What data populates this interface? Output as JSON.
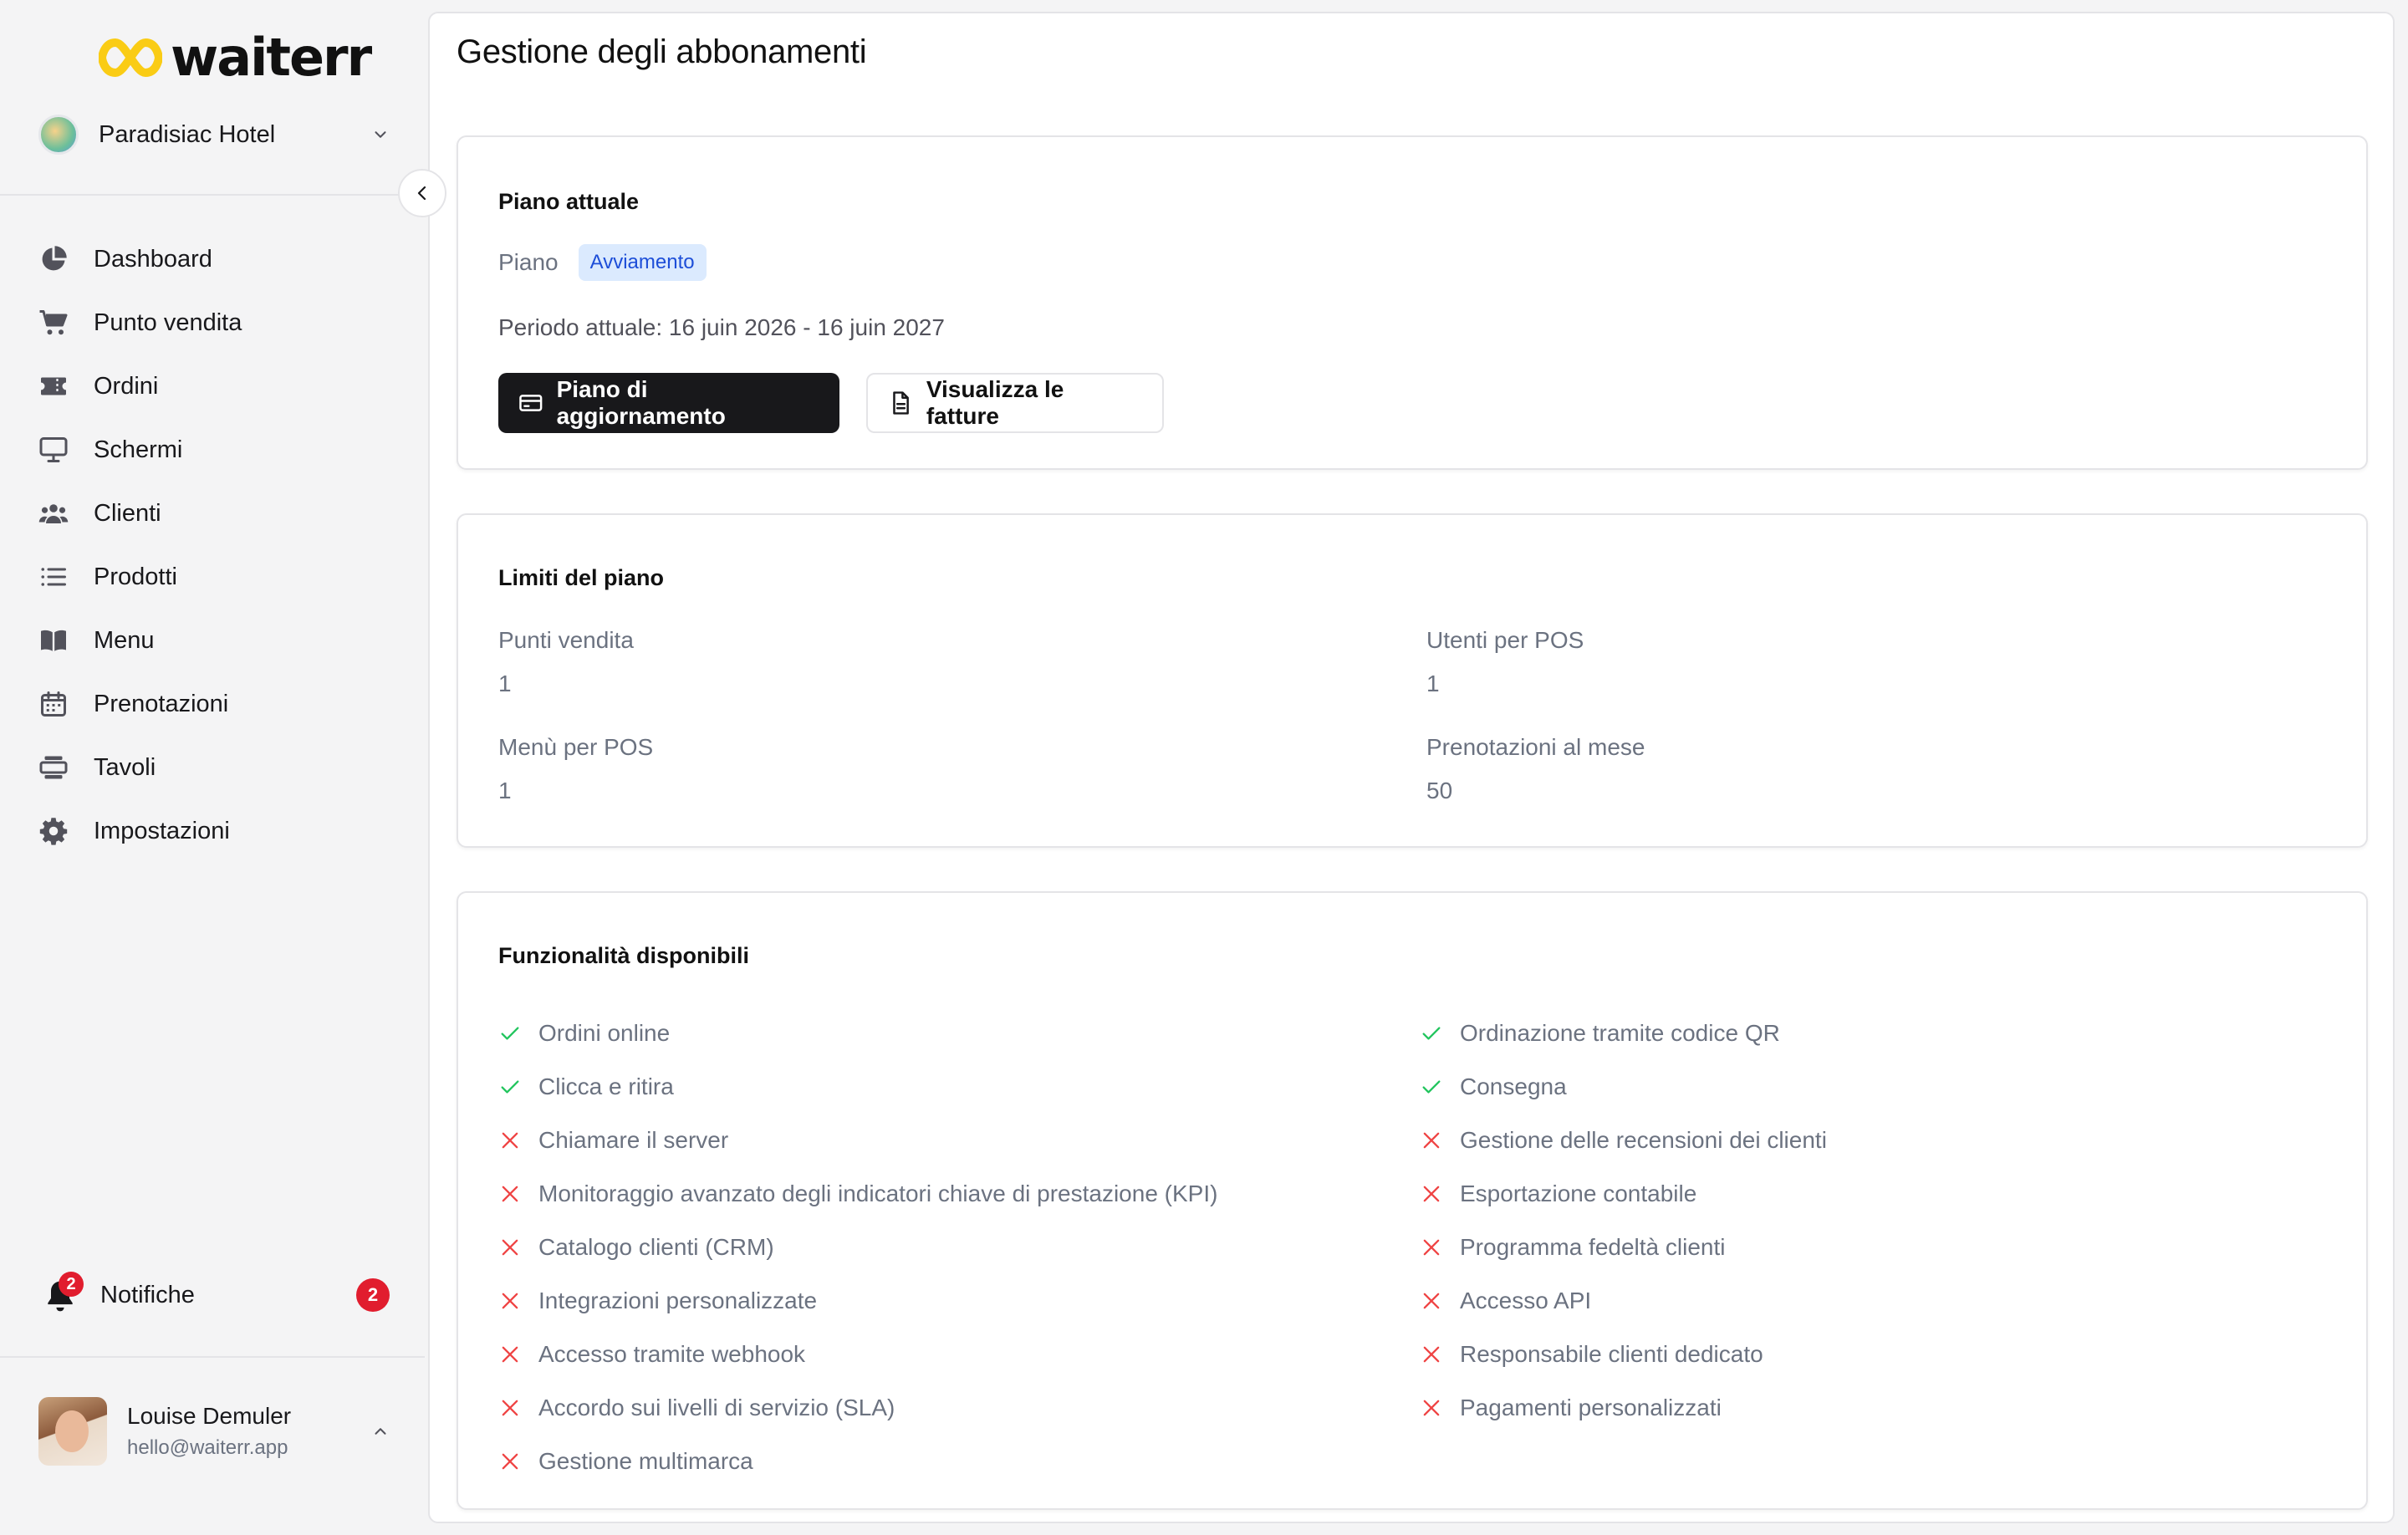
{
  "brand": {
    "name": "waiterr"
  },
  "org": {
    "name": "Paradisiac Hotel"
  },
  "nav": [
    {
      "label": "Dashboard",
      "icon": "pie-chart-icon"
    },
    {
      "label": "Punto vendita",
      "icon": "cart-icon"
    },
    {
      "label": "Ordini",
      "icon": "ticket-icon"
    },
    {
      "label": "Schermi",
      "icon": "monitor-icon"
    },
    {
      "label": "Clienti",
      "icon": "users-icon"
    },
    {
      "label": "Prodotti",
      "icon": "list-icon"
    },
    {
      "label": "Menu",
      "icon": "book-icon"
    },
    {
      "label": "Prenotazioni",
      "icon": "calendar-icon"
    },
    {
      "label": "Tavoli",
      "icon": "table-icon"
    },
    {
      "label": "Impostazioni",
      "icon": "gear-icon"
    }
  ],
  "notifications": {
    "label": "Notifiche",
    "count": "2"
  },
  "user": {
    "name": "Louise Demuler",
    "email": "hello@waiterr.app"
  },
  "page": {
    "title": "Gestione degli abbonamenti"
  },
  "current_plan": {
    "title": "Piano attuale",
    "plan_label": "Piano",
    "plan_badge": "Avviamento",
    "period": "Periodo attuale: 16 juin 2026 - 16 juin 2027",
    "upgrade_button": "Piano di aggiornamento",
    "invoices_button": "Visualizza le fatture"
  },
  "limits": {
    "title": "Limiti del piano",
    "items": [
      {
        "label": "Punti vendita",
        "value": "1"
      },
      {
        "label": "Utenti per POS",
        "value": "1"
      },
      {
        "label": "Menù per POS",
        "value": "1"
      },
      {
        "label": "Prenotazioni al mese",
        "value": "50"
      }
    ]
  },
  "features": {
    "title": "Funzionalità disponibili",
    "left": [
      {
        "label": "Ordini online",
        "available": true
      },
      {
        "label": "Clicca e ritira",
        "available": true
      },
      {
        "label": "Chiamare il server",
        "available": false
      },
      {
        "label": "Monitoraggio avanzato degli indicatori chiave di prestazione (KPI)",
        "available": false
      },
      {
        "label": "Catalogo clienti (CRM)",
        "available": false
      },
      {
        "label": "Integrazioni personalizzate",
        "available": false
      },
      {
        "label": "Accesso tramite webhook",
        "available": false
      },
      {
        "label": "Accordo sui livelli di servizio (SLA)",
        "available": false
      },
      {
        "label": "Gestione multimarca",
        "available": false
      }
    ],
    "right": [
      {
        "label": "Ordinazione tramite codice QR",
        "available": true
      },
      {
        "label": "Consegna",
        "available": true
      },
      {
        "label": "Gestione delle recensioni dei clienti",
        "available": false
      },
      {
        "label": "Esportazione contabile",
        "available": false
      },
      {
        "label": "Programma fedeltà clienti",
        "available": false
      },
      {
        "label": "Accesso API",
        "available": false
      },
      {
        "label": "Responsabile clienti dedicato",
        "available": false
      },
      {
        "label": "Pagamenti personalizzati",
        "available": false
      }
    ]
  },
  "colors": {
    "accent_dark": "#18181b",
    "badge_bg": "#dbeafe",
    "badge_text": "#1d4ed8",
    "check_green": "#22c55e",
    "cross_red": "#ef4444",
    "notification_red": "#e11d2e",
    "logo_yellow": "#facc15"
  }
}
